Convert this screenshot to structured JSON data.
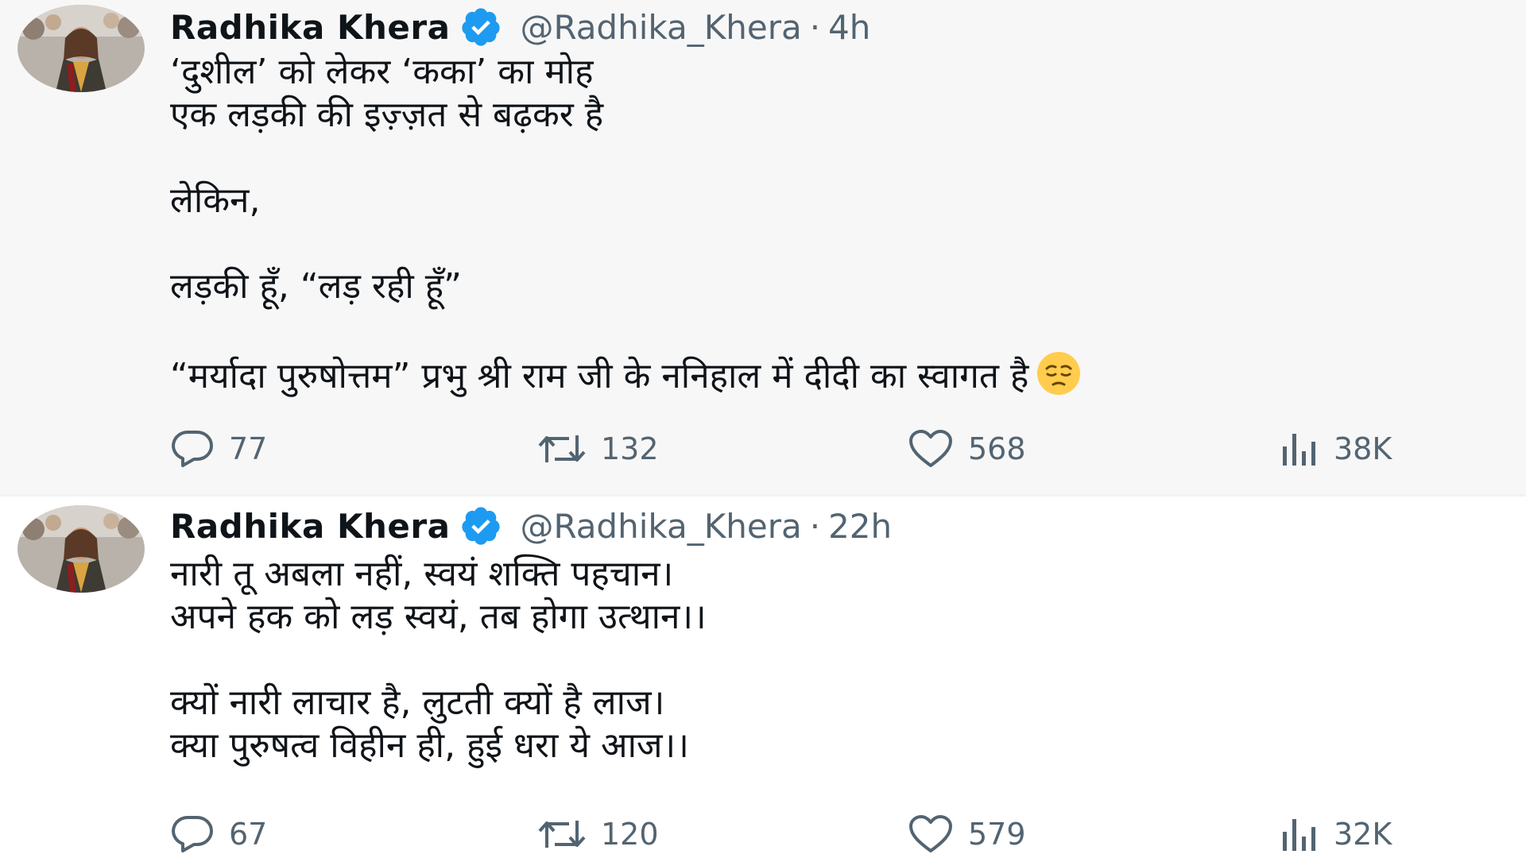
{
  "colors": {
    "text_primary": "#0f1419",
    "text_secondary": "#536471",
    "verified_blue": "#1d9bf0",
    "highlight_bg": "#f7f7f7"
  },
  "tweets": [
    {
      "author_name": "Radhika Khera",
      "handle": "@Radhika_Khera",
      "separator": "·",
      "time": "4h",
      "verified": true,
      "lines": [
        "‘दुशील’ को लेकर ‘कका’ का मोह",
        "एक लड़की की इज़्ज़त से बढ़कर है",
        "",
        "लेकिन,",
        "",
        "लड़की हूँ, “लड़ रही हूँ”",
        "",
        "“मर्यादा पुरुषोत्तम” प्रभु श्री राम जी के ननिहाल में दीदी का स्वागत है"
      ],
      "trailing_emoji": "pensive-face-emoji",
      "replies": "77",
      "retweets": "132",
      "likes": "568",
      "views": "38K"
    },
    {
      "author_name": "Radhika Khera",
      "handle": "@Radhika_Khera",
      "separator": "·",
      "time": "22h",
      "verified": true,
      "lines": [
        "नारी तू अबला नहीं, स्वयं शक्ति पहचान।",
        "अपने हक को लड़ स्वयं, तब होगा उत्थान।।",
        "",
        "क्यों नारी लाचार है, लुटती क्यों है लाज।",
        "क्या पुरुषत्व विहीन ही, हुई धरा ये आज।।"
      ],
      "replies": "67",
      "retweets": "120",
      "likes": "579",
      "views": "32K"
    }
  ]
}
